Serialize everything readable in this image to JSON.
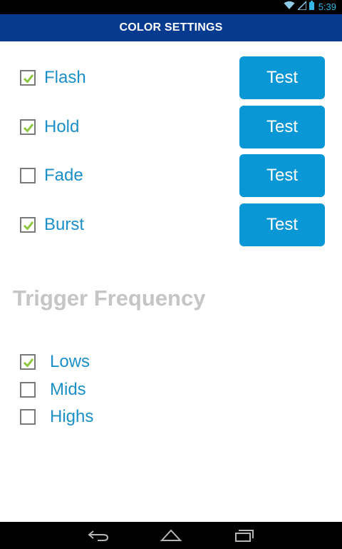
{
  "status_bar": {
    "time": "5:39",
    "icons": [
      "wifi-icon",
      "signal-icon",
      "battery-icon"
    ]
  },
  "header": {
    "title": "COLOR SETTINGS"
  },
  "effects": [
    {
      "label": "Flash",
      "checked": true,
      "button": "Test"
    },
    {
      "label": "Hold",
      "checked": true,
      "button": "Test"
    },
    {
      "label": "Fade",
      "checked": false,
      "button": "Test"
    },
    {
      "label": "Burst",
      "checked": true,
      "button": "Test"
    }
  ],
  "trigger_frequency": {
    "heading": "Trigger Frequency",
    "options": [
      {
        "label": "Lows",
        "checked": true
      },
      {
        "label": "Mids",
        "checked": false
      },
      {
        "label": "Highs",
        "checked": false
      }
    ]
  },
  "nav_bar": {
    "icons": [
      "back-icon",
      "home-icon",
      "recent-apps-icon"
    ]
  },
  "colors": {
    "header_bg": "#063a8e",
    "accent": "#0a97d6",
    "label": "#1b8fc8",
    "check": "#8cc63f"
  }
}
